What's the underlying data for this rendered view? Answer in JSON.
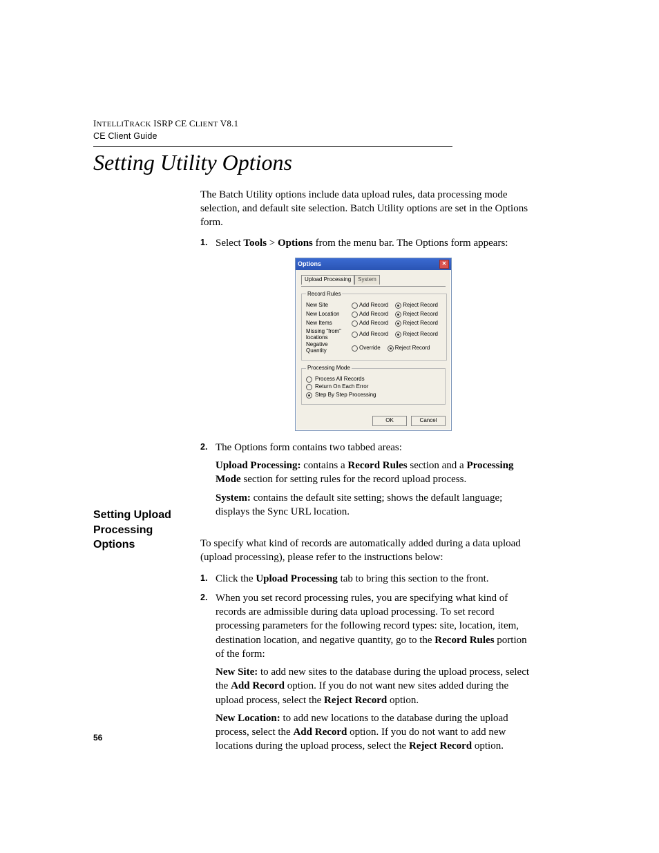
{
  "header": {
    "line1_pre": "I",
    "line1_sc": "NTELLI",
    "line1_mid": "T",
    "line1_sc2": "RACK",
    "line1_rest": " ISRP CE C",
    "line1_sc3": "LIENT",
    "line1_ver": " V8.1",
    "line2": "CE Client Guide"
  },
  "title": "Setting Utility Options",
  "intro": "The Batch Utility options include data upload rules, data processing mode selection, and default site selection. Batch Utility options are set in the Options form.",
  "step1": {
    "num": "1.",
    "pre": "Select ",
    "b1": "Tools",
    "mid": " > ",
    "b2": "Options",
    "post": " from the menu bar. The Options form appears:"
  },
  "dialog": {
    "title": "Options",
    "tabs": {
      "t1": "Upload Processing",
      "t2": "System"
    },
    "group_rules": "Record Rules",
    "rules": [
      {
        "label": "New Site",
        "a": "Add Record",
        "b": "Reject Record",
        "sel": "b"
      },
      {
        "label": "New Location",
        "a": "Add Record",
        "b": "Reject Record",
        "sel": "b"
      },
      {
        "label": "New Items",
        "a": "Add Record",
        "b": "Reject Record",
        "sel": "b"
      },
      {
        "label": "Missing \"from\" locations",
        "a": "Add Record",
        "b": "Reject Record",
        "sel": "b"
      },
      {
        "label": "Negative Quantity",
        "a": "Override",
        "b": "Reject Record",
        "sel": "b"
      }
    ],
    "group_mode": "Processing Mode",
    "modes": [
      {
        "label": "Process All Records",
        "sel": false
      },
      {
        "label": "Return On Each Error",
        "sel": false
      },
      {
        "label": "Step By Step Processing",
        "sel": true
      }
    ],
    "ok": "OK",
    "cancel": "Cancel"
  },
  "step2": {
    "num": "2.",
    "lead": "The Options form contains two tabbed areas:",
    "up_b": "Upload Processing:",
    "up_mid1": " contains a ",
    "up_b2": "Record Rules",
    "up_mid2": " section and a ",
    "up_b3": "Processing Mode",
    "up_post": " section for setting rules for the record upload process.",
    "sys_b": "System:",
    "sys_post": " contains the default site setting; shows the default language; displays the Sync URL location."
  },
  "sidehead": "Setting Upload Processing Options",
  "sec2_intro": "To specify what kind of records are automatically added during a data upload (upload processing), please refer to the instructions below:",
  "s2_step1": {
    "num": "1.",
    "pre": "Click the ",
    "b": "Upload Processing",
    "post": " tab to bring this section to the front."
  },
  "s2_step2": {
    "num": "2.",
    "pre": "When you set record processing rules, you are specifying what kind of records are admissible during data upload processing. To set record processing parameters for the following record types: site, location, item, destination location, and negative quantity, go to the ",
    "b": "Record Rules",
    "post": " portion of the form:"
  },
  "ns": {
    "b": "New Site:",
    "t1": " to add new sites to the database during the upload process, select the ",
    "b2": "Add Record",
    "t2": " option. If you do not want new sites added during the upload process, select the ",
    "b3": "Reject Record",
    "t3": " option."
  },
  "nl": {
    "b": "New Location:",
    "t1": " to add new locations to the database during the upload process, select the ",
    "b2": "Add Record",
    "t2": " option. If you do not want to add new locations during the upload process, select the ",
    "b3": "Reject Record",
    "t3": " option."
  },
  "pagenum": "56"
}
